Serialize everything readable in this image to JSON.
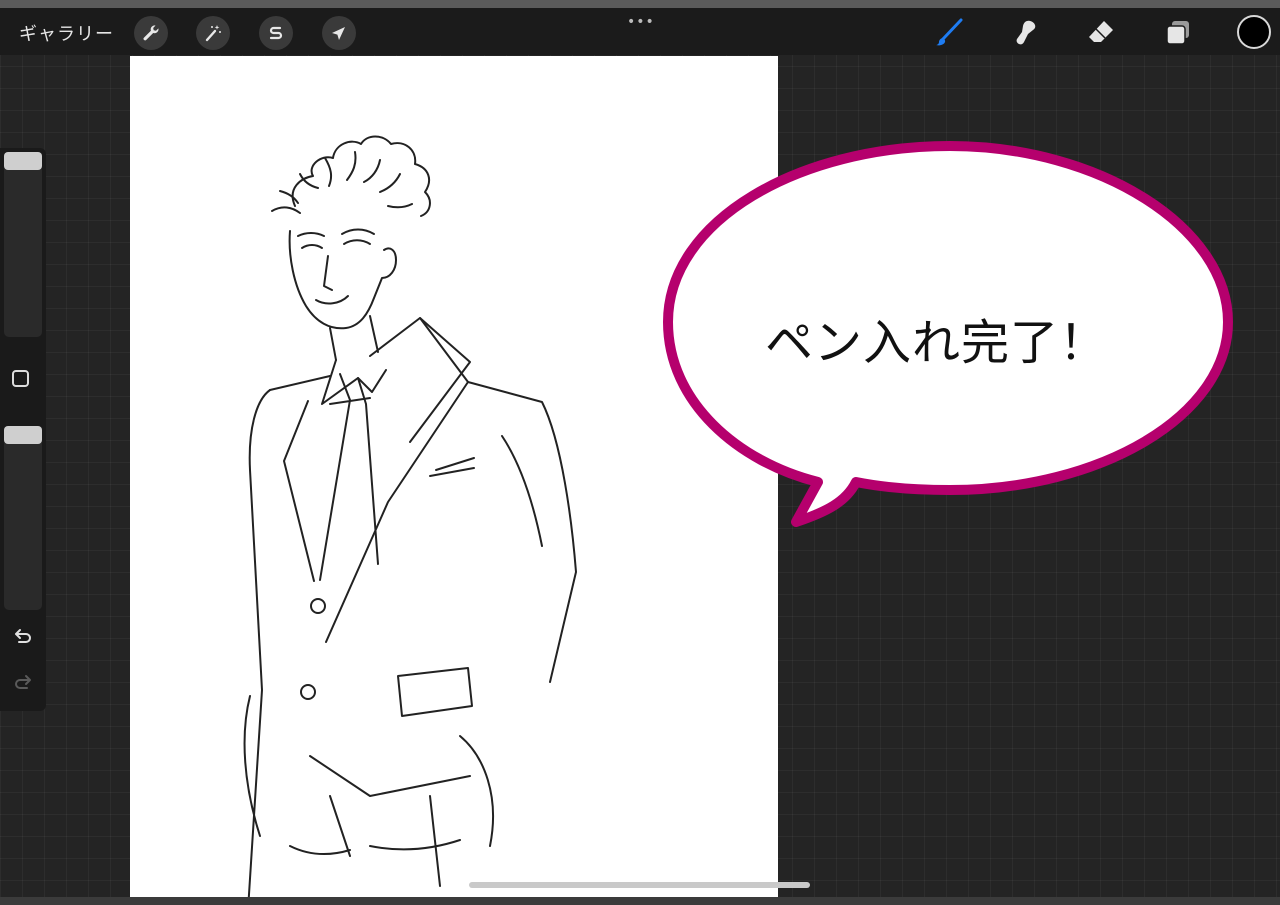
{
  "toolbar": {
    "gallery_label": "ギャラリー",
    "left_icons": [
      "wrench-icon",
      "magic-wand-icon",
      "selection-s-icon",
      "transform-arrow-icon"
    ],
    "more_dots": "•••",
    "right_icons": [
      "brush-icon",
      "smudge-icon",
      "eraser-icon",
      "layers-icon"
    ],
    "active_tool": "brush-icon",
    "accent_color": "#1e7cf2",
    "current_color": "#000000"
  },
  "sidebar": {
    "brush_size_level": 0.0,
    "opacity_level": 0.0,
    "icons": [
      "modify-square-icon",
      "undo-icon",
      "redo-icon"
    ]
  },
  "speech_bubble": {
    "text": "ペン入れ完了！",
    "border_color": "#b5006d"
  }
}
